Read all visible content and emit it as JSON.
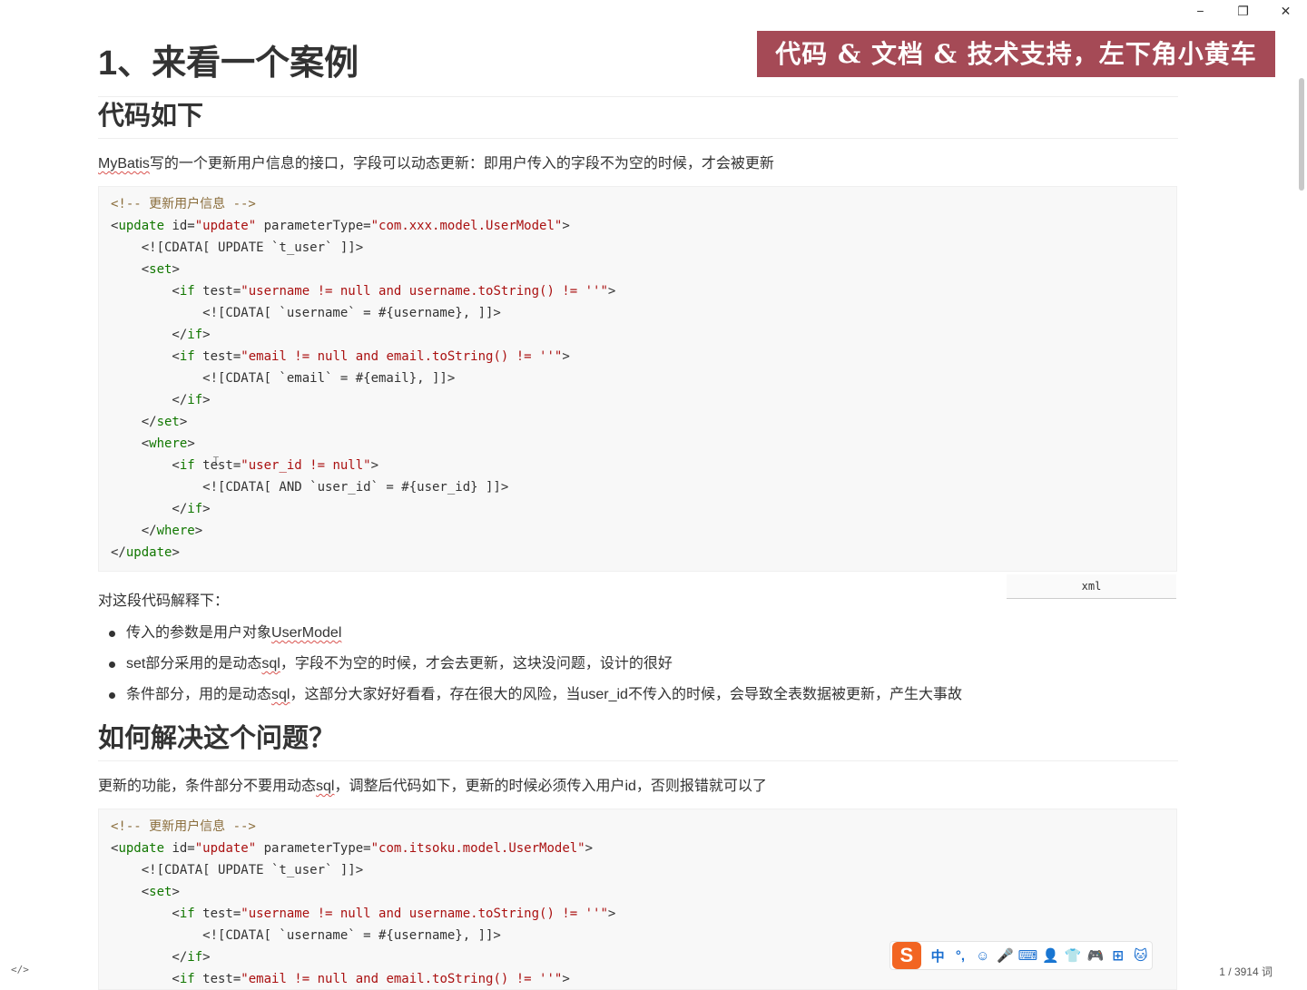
{
  "window": {
    "minimize": "−",
    "restore": "❐",
    "close": "✕"
  },
  "banner": "代码 & 文档 & 技术支持，左下角小黄车",
  "heading1": "1、来看一个案例",
  "section1": {
    "title": "代码如下",
    "intro_link": "MyBatis",
    "intro_rest": "写的一个更新用户信息的接口，字段可以动态更新：即用户传入的字段不为空的时候，才会被更新"
  },
  "code1": {
    "lang": "xml",
    "lines": [
      "<!-- 更新用户信息 -->",
      "<update id=\"update\" parameterType=\"com.xxx.model.UserModel\">",
      "    <![CDATA[ UPDATE `t_user` ]]>",
      "    <set>",
      "        <if test=\"username != null and username.toString() != ''\">",
      "            <![CDATA[ `username` = #{username}, ]]>",
      "        </if>",
      "        <if test=\"email != null and email.toString() != ''\">",
      "            <![CDATA[ `email` = #{email}, ]]>",
      "        </if>",
      "    </set>",
      "    <where>",
      "        <if test=\"user_id != null\">",
      "            <![CDATA[ AND `user_id` = #{user_id} ]]>",
      "        </if>",
      "    </where>",
      "</update>"
    ]
  },
  "explain_intro": "对这段代码解释下：",
  "bullets": [
    {
      "pre": "传入的参数是用户对象",
      "link": "UserModel",
      "post": ""
    },
    {
      "pre": "set部分采用的是动态",
      "link": "sql",
      "post": "，字段不为空的时候，才会去更新，这块没问题，设计的很好"
    },
    {
      "pre": "条件部分，用的是动态",
      "link": "sql",
      "post": "，这部分大家好好看看，存在很大的风险，当user_id不传入的时候，会导致全表数据被更新，产生大事故"
    }
  ],
  "section2": {
    "title": "如何解决这个问题？",
    "intro_pre": "更新的功能，条件部分不要用动态",
    "intro_link": "sql",
    "intro_post": "，调整后代码如下，更新的时候必须传入用户id，否则报错就可以了"
  },
  "code2": {
    "lines": [
      "<!-- 更新用户信息 -->",
      "<update id=\"update\" parameterType=\"com.itsoku.model.UserModel\">",
      "    <![CDATA[ UPDATE `t_user` ]]>",
      "    <set>",
      "        <if test=\"username != null and username.toString() != ''\">",
      "            <![CDATA[ `username` = #{username}, ]]>",
      "        </if>",
      "        <if test=\"email != null and email.toString() != ''\">"
    ]
  },
  "status": {
    "source_toggle": "</>",
    "word_count": "1 / 3914 词"
  },
  "ime": {
    "logo": "S",
    "items": [
      "中",
      "°,",
      "☺",
      "🎤",
      "⌨",
      "👤",
      "👕",
      "🎮",
      "⊞",
      "🐱"
    ]
  },
  "colors": {
    "banner_bg": "#a54a56",
    "code_bg": "#f8f8f8",
    "tag": "#117700",
    "string": "#aa1111",
    "comment": "#8a6d3b"
  }
}
